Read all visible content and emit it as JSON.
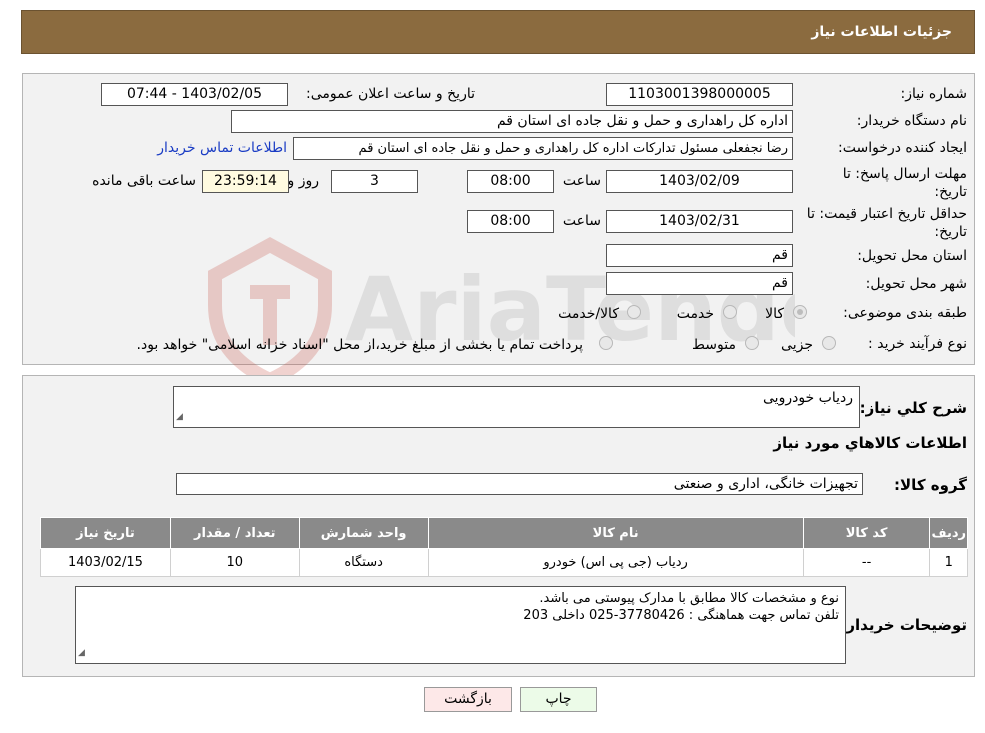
{
  "header": {
    "title": "جزئیات اطلاعات نیاز"
  },
  "form": {
    "need_number": {
      "label": "شماره نیاز:",
      "value": "1103001398000005"
    },
    "announce": {
      "label": "تاریخ و ساعت اعلان عمومی:",
      "value": "1403/02/05 - 07:44"
    },
    "buyer": {
      "label": "نام دستگاه خریدار:",
      "value": "اداره کل راهداری و حمل و نقل جاده ای استان قم"
    },
    "creator": {
      "label": "ایجاد کننده درخواست:",
      "value": "رضا  نجفعلی مسئول تدارکات اداره کل راهداری و حمل و نقل جاده ای استان قم",
      "contact_link": "اطلاعات تماس خریدار"
    },
    "deadline": {
      "label_line1": "مهلت ارسال پاسخ: تا",
      "label_line2": "تاریخ:",
      "date": "1403/02/09",
      "time_label": "ساعت",
      "time": "08:00",
      "days": "3",
      "days_label": "روز و",
      "remaining": "23:59:14",
      "remaining_label": "ساعت باقی مانده"
    },
    "price_validity": {
      "label_line1": "حداقل تاریخ اعتبار قیمت: تا",
      "label_line2": "تاریخ:",
      "date": "1403/02/31",
      "time_label": "ساعت",
      "time": "08:00"
    },
    "province": {
      "label": "استان محل تحویل:",
      "value": "قم"
    },
    "city": {
      "label": "شهر محل تحویل:",
      "value": "قم"
    },
    "category": {
      "label": "طبقه بندی موضوعی:",
      "options": [
        "کالا",
        "خدمت",
        "کالا/خدمت"
      ],
      "selected": "کالا"
    },
    "process": {
      "label": "نوع فرآیند خرید :",
      "options": [
        "جزیی",
        "متوسط"
      ],
      "note": "پرداخت تمام یا بخشی از مبلغ خرید،از محل \"اسناد خزانه اسلامی\" خواهد بود."
    }
  },
  "details": {
    "summary_label": "شرح کلي نياز:",
    "summary_value": "ردیاب خودرویی",
    "goods_heading": "اطلاعات کالاهاي مورد نياز",
    "group_label": "گروه کالا:",
    "group_value": "تجهیزات خانگی، اداری و صنعتی",
    "table": {
      "headers": [
        "رديف",
        "کد کالا",
        "نام کالا",
        "واحد شمارش",
        "تعداد / مقدار",
        "تاريخ نياز"
      ],
      "rows": [
        [
          "1",
          "--",
          "ردیاب (جی پی اس) خودرو",
          "دستگاه",
          "10",
          "1403/02/15"
        ]
      ]
    },
    "buyer_notes_label": "توضیحات خریدار:",
    "buyer_notes_line1": "نوع و مشخصات کالا مطابق با مدارک پیوستی می باشد.",
    "buyer_notes_line2": "تلفن تماس جهت هماهنگی : 37780426-025 داخلی 203"
  },
  "buttons": {
    "print": "چاپ",
    "back": "بازگشت"
  },
  "watermark": {
    "text": "AriaTender.neT"
  },
  "colors": {
    "header": "#8b6b3f",
    "table_header": "#8a8a8a",
    "watermark": "#c0392b"
  }
}
